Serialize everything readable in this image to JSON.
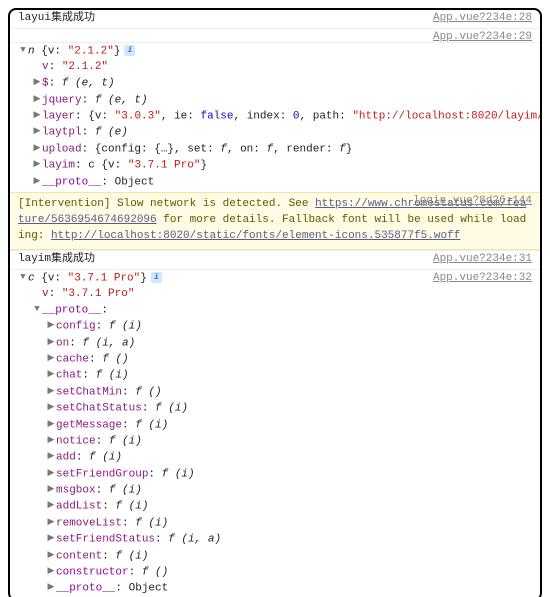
{
  "rows": [
    {
      "type": "log",
      "msg": "layui集成成功",
      "src": "App.vue?234e:28"
    },
    {
      "type": "spacer",
      "src": "App.vue?234e:29"
    },
    {
      "type": "tree",
      "expanded": true,
      "summary_pre": "n ",
      "summary_val": "{v: \"2.1.2\"}",
      "info": true,
      "indent": 0,
      "children": [
        {
          "k": "v",
          "v": "\"2.1.2\"",
          "vclass": "str",
          "tw": "",
          "indent": 1
        },
        {
          "k": "$",
          "v": "f (e, t)",
          "vclass": "fn",
          "tw": "▶",
          "indent": 1
        },
        {
          "k": "jquery",
          "v": "f (e, t)",
          "vclass": "fn",
          "tw": "▶",
          "indent": 1
        },
        {
          "raw": true,
          "tw": "▶",
          "indent": 1,
          "html": [
            {
              "t": "layer",
              "c": "key"
            },
            {
              "t": ": {",
              "c": "punc"
            },
            {
              "t": "v",
              "c": "obj"
            },
            {
              "t": ": ",
              "c": "punc"
            },
            {
              "t": "\"3.0.3\"",
              "c": "str"
            },
            {
              "t": ", ",
              "c": "punc"
            },
            {
              "t": "ie",
              "c": "obj"
            },
            {
              "t": ": ",
              "c": "punc"
            },
            {
              "t": "false",
              "c": "bool"
            },
            {
              "t": ", ",
              "c": "punc"
            },
            {
              "t": "index",
              "c": "obj"
            },
            {
              "t": ": ",
              "c": "punc"
            },
            {
              "t": "0",
              "c": "num"
            },
            {
              "t": ", ",
              "c": "punc"
            },
            {
              "t": "path",
              "c": "obj"
            },
            {
              "t": ": ",
              "c": "punc"
            },
            {
              "t": "\"http://localhost:8020/layim/…",
              "c": "str"
            }
          ]
        },
        {
          "k": "laytpl",
          "v": "f (e)",
          "vclass": "fn",
          "tw": "▶",
          "indent": 1
        },
        {
          "raw": true,
          "tw": "▶",
          "indent": 1,
          "html": [
            {
              "t": "upload",
              "c": "key"
            },
            {
              "t": ": {",
              "c": "punc"
            },
            {
              "t": "config",
              "c": "obj"
            },
            {
              "t": ": {…}, ",
              "c": "punc"
            },
            {
              "t": "set",
              "c": "obj"
            },
            {
              "t": ": ",
              "c": "punc"
            },
            {
              "t": "f",
              "c": "fn"
            },
            {
              "t": ", ",
              "c": "punc"
            },
            {
              "t": "on",
              "c": "obj"
            },
            {
              "t": ": ",
              "c": "punc"
            },
            {
              "t": "f",
              "c": "fn"
            },
            {
              "t": ", ",
              "c": "punc"
            },
            {
              "t": "render",
              "c": "obj"
            },
            {
              "t": ": ",
              "c": "punc"
            },
            {
              "t": "f",
              "c": "fn"
            },
            {
              "t": "}",
              "c": "punc"
            }
          ]
        },
        {
          "raw": true,
          "tw": "▶",
          "indent": 1,
          "html": [
            {
              "t": "layim",
              "c": "key"
            },
            {
              "t": ": c {",
              "c": "punc"
            },
            {
              "t": "v",
              "c": "obj"
            },
            {
              "t": ": ",
              "c": "punc"
            },
            {
              "t": "\"3.7.1 Pro\"",
              "c": "str"
            },
            {
              "t": "}",
              "c": "punc"
            }
          ]
        },
        {
          "k": "__proto__",
          "v": "Object",
          "vclass": "obj",
          "tw": "▶",
          "indent": 1,
          "kclass": "dim"
        }
      ]
    },
    {
      "type": "warn",
      "src": "login.vue?8d26:144",
      "pre": "[Intervention] Slow network is detected. See ",
      "link1": "https://www.chromestatus.com/feature/5636954674692096",
      "mid": " for more details. Fallback font will be used while loading: ",
      "link2": "http://localhost:8020/static/fonts/element-icons.535877f5.woff"
    },
    {
      "type": "log",
      "msg": "layim集成成功",
      "src": "App.vue?234e:31"
    },
    {
      "type": "tree",
      "src": "App.vue?234e:32",
      "expanded": true,
      "summary_pre": "c ",
      "summary_val": "{v: \"3.7.1 Pro\"}",
      "info": true,
      "indent": 0,
      "children": [
        {
          "k": "v",
          "v": "\"3.7.1 Pro\"",
          "vclass": "str",
          "tw": "",
          "indent": 1
        },
        {
          "k": "__proto__",
          "v": "",
          "vclass": "obj",
          "tw": "▼",
          "indent": 1,
          "kclass": "dim",
          "open": true
        },
        {
          "k": "config",
          "v": "f (i)",
          "vclass": "fn",
          "tw": "▶",
          "indent": 2
        },
        {
          "k": "on",
          "v": "f (i, a)",
          "vclass": "fn",
          "tw": "▶",
          "indent": 2
        },
        {
          "k": "cache",
          "v": "f ()",
          "vclass": "fn",
          "tw": "▶",
          "indent": 2
        },
        {
          "k": "chat",
          "v": "f (i)",
          "vclass": "fn",
          "tw": "▶",
          "indent": 2
        },
        {
          "k": "setChatMin",
          "v": "f ()",
          "vclass": "fn",
          "tw": "▶",
          "indent": 2
        },
        {
          "k": "setChatStatus",
          "v": "f (i)",
          "vclass": "fn",
          "tw": "▶",
          "indent": 2
        },
        {
          "k": "getMessage",
          "v": "f (i)",
          "vclass": "fn",
          "tw": "▶",
          "indent": 2
        },
        {
          "k": "notice",
          "v": "f (i)",
          "vclass": "fn",
          "tw": "▶",
          "indent": 2
        },
        {
          "k": "add",
          "v": "f (i)",
          "vclass": "fn",
          "tw": "▶",
          "indent": 2
        },
        {
          "k": "setFriendGroup",
          "v": "f (i)",
          "vclass": "fn",
          "tw": "▶",
          "indent": 2
        },
        {
          "k": "msgbox",
          "v": "f (i)",
          "vclass": "fn",
          "tw": "▶",
          "indent": 2
        },
        {
          "k": "addList",
          "v": "f (i)",
          "vclass": "fn",
          "tw": "▶",
          "indent": 2
        },
        {
          "k": "removeList",
          "v": "f (i)",
          "vclass": "fn",
          "tw": "▶",
          "indent": 2
        },
        {
          "k": "setFriendStatus",
          "v": "f (i, a)",
          "vclass": "fn",
          "tw": "▶",
          "indent": 2
        },
        {
          "k": "content",
          "v": "f (i)",
          "vclass": "fn",
          "tw": "▶",
          "indent": 2
        },
        {
          "k": "constructor",
          "v": "f ()",
          "vclass": "fn",
          "tw": "▶",
          "indent": 2,
          "kclass": "dim"
        },
        {
          "k": "__proto__",
          "v": "Object",
          "vclass": "obj",
          "tw": "▶",
          "indent": 2,
          "kclass": "dim"
        }
      ]
    }
  ]
}
